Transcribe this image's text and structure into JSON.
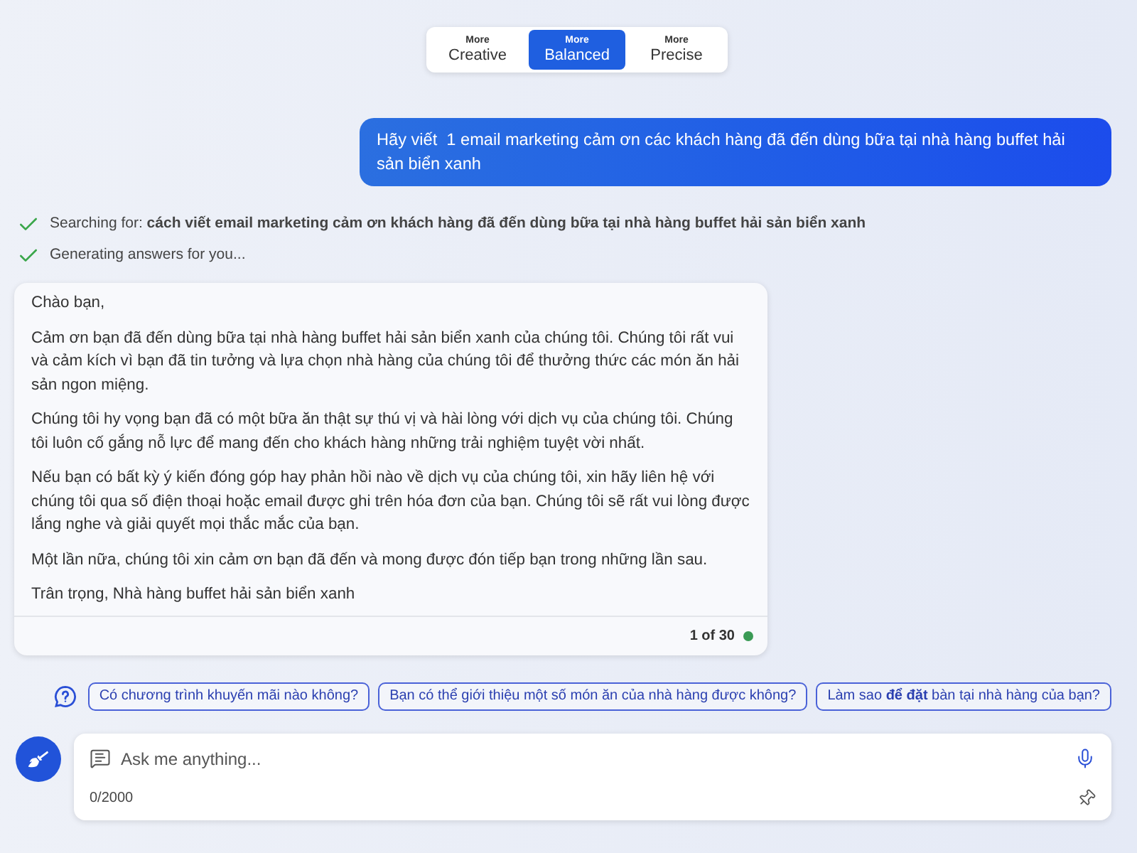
{
  "tone_selector": {
    "options": [
      {
        "top": "More",
        "label": "Creative",
        "selected": false
      },
      {
        "top": "More",
        "label": "Balanced",
        "selected": true
      },
      {
        "top": "More",
        "label": "Precise",
        "selected": false
      }
    ]
  },
  "user_message": {
    "text": "Hãy viết  1 email marketing cảm ơn các khách hàng đã đến dùng bữa tại nhà hàng buffet hải sản biển xanh"
  },
  "progress": [
    {
      "text": "Searching for: **cách viết email marketing cảm ơn khách hàng đã đến dùng bữa tại nhà hàng buffet hải sản biển xanh**",
      "done": true
    },
    {
      "text": "Generating answers for you...",
      "done": true
    }
  ],
  "answer": {
    "paragraphs": [
      "Chào bạn,",
      "Cảm ơn bạn đã đến dùng bữa tại nhà hàng buffet hải sản biển xanh của chúng tôi. Chúng tôi rất vui và cảm kích vì bạn đã tin tưởng và lựa chọn nhà hàng của chúng tôi để thưởng thức các món ăn hải sản ngon miệng.",
      "Chúng tôi hy vọng bạn đã có một bữa ăn thật sự thú vị và hài lòng với dịch vụ của chúng tôi. Chúng tôi luôn cố gắng nỗ lực để mang đến cho khách hàng những trải nghiệm tuyệt vời nhất.",
      "Nếu bạn có bất kỳ ý kiến đóng góp hay phản hồi nào về dịch vụ của chúng tôi, xin hãy liên hệ với chúng tôi qua số điện thoại hoặc email được ghi trên hóa đơn của bạn. Chúng tôi sẽ rất vui lòng được lắng nghe và giải quyết mọi thắc mắc của bạn.",
      "Một lần nữa, chúng tôi xin cảm ơn bạn đã đến và mong được đón tiếp bạn trong những lần sau.",
      "Trân trọng, Nhà hàng buffet hải sản biển xanh"
    ],
    "counter": "1 of 30"
  },
  "suggestions": [
    "Có chương trình khuyến mãi nào không?",
    "Bạn có thể giới thiệu một số món ăn của nhà hàng được không?",
    "Làm sao **để đặt** bàn tại nhà hàng của bạn?"
  ],
  "input": {
    "placeholder": "Ask me anything...",
    "counter": "0/2000"
  }
}
